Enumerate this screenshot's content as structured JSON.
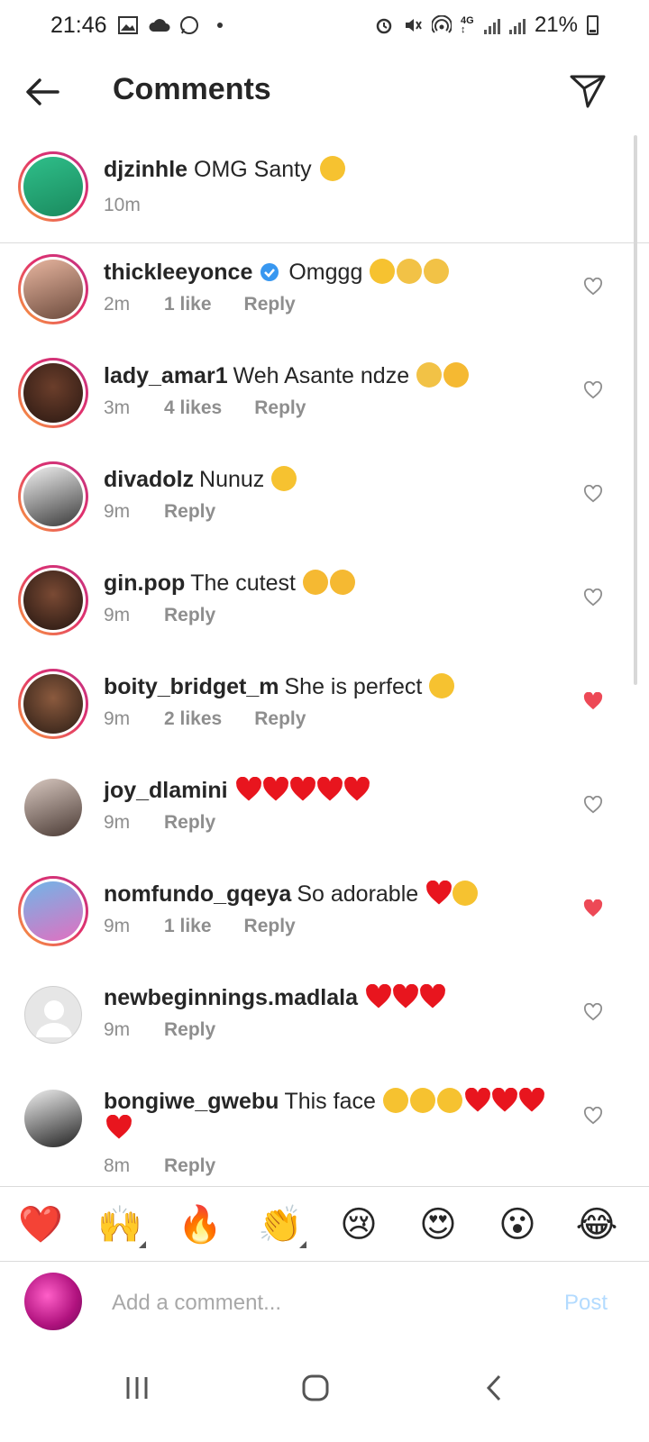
{
  "status": {
    "time": "21:46",
    "battery": "21%"
  },
  "header": {
    "title": "Comments"
  },
  "caption": {
    "username": "djzinhle",
    "text": "OMG Santy",
    "time": "10m"
  },
  "comments": [
    {
      "username": "thickleeyonce",
      "verified": true,
      "text": "Omggg",
      "time": "2m",
      "likes": "1 like",
      "reply": "Reply",
      "liked": false
    },
    {
      "username": "lady_amar1",
      "text": "Weh Asante ndze",
      "time": "3m",
      "likes": "4 likes",
      "reply": "Reply",
      "liked": false
    },
    {
      "username": "divadolz",
      "text": "Nunuz",
      "time": "9m",
      "likes": "",
      "reply": "Reply",
      "liked": false
    },
    {
      "username": "gin.pop",
      "text": "The cutest",
      "time": "9m",
      "likes": "",
      "reply": "Reply",
      "liked": false
    },
    {
      "username": "boity_bridget_m",
      "text": "She is perfect",
      "time": "9m",
      "likes": "2 likes",
      "reply": "Reply",
      "liked": true
    },
    {
      "username": "joy_dlamini",
      "text": "",
      "time": "9m",
      "likes": "",
      "reply": "Reply",
      "liked": false
    },
    {
      "username": "nomfundo_gqeya",
      "text": "So adorable",
      "time": "9m",
      "likes": "1 like",
      "reply": "Reply",
      "liked": true
    },
    {
      "username": "newbeginnings.madlala",
      "text": "",
      "time": "9m",
      "likes": "",
      "reply": "Reply",
      "liked": false
    },
    {
      "username": "bongiwe_gwebu",
      "text": "This face",
      "time": "8m",
      "likes": "",
      "reply": "Reply",
      "liked": false
    }
  ],
  "reactions": [
    "❤️",
    "🙌",
    "🔥",
    "👏",
    "😢",
    "😍",
    "😮",
    "😂"
  ],
  "composer": {
    "placeholder": "Add a comment...",
    "post_label": "Post"
  },
  "colors": {
    "like_red": "#ed4956",
    "accent_blue": "#0095f6",
    "muted": "#8e8e8e"
  }
}
